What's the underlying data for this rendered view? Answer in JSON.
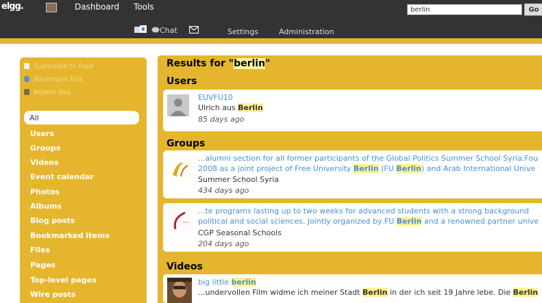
{
  "topbar": {
    "logo": "elgg.",
    "nav": [
      "Dashboard",
      "Tools"
    ],
    "search_value": "berlin",
    "go_label": "Go"
  },
  "secondbar": {
    "chat": "Chat",
    "settings": "Settings",
    "administration": "Administration"
  },
  "sidebar": {
    "owner_links": [
      "Subscribe to feed",
      "Bookmark this",
      "Report this"
    ],
    "menu": [
      "All",
      "Users",
      "Groups",
      "Videos",
      "Event calendar",
      "Photos",
      "Albums",
      "Blog posts",
      "Bookmarked items",
      "Files",
      "Pages",
      "Top-level pages",
      "Wire posts"
    ]
  },
  "results": {
    "title_prefix": "Results for \"",
    "query": "berlin",
    "title_suffix": "\"",
    "keyword": "Berlin",
    "keyword_lower": "berlin",
    "users_title": "Users",
    "groups_title": "Groups",
    "videos_title": "Videos",
    "user": {
      "name": "EUVFU10",
      "desc_prefix": "Ulrich aus ",
      "time": "85 days ago"
    },
    "group1": {
      "line1": "...alumni section for all former participants of the Global Politics Summer School Syria.Fou",
      "line2_a": "2008 as a joint project of Free University ",
      "line2_b": " (FU ",
      "line2_c": ") and Arab International Unive",
      "name": "Summer School Syria",
      "time": "434 days ago"
    },
    "group2": {
      "line1": "...te programs lasting up to two weeks for advanced students with a strong background",
      "line2_a": "political and social sciences. Jointly organized by FU ",
      "line2_b": " and a renowned partner unive",
      "name": "CGP Seasonal Schools",
      "time": "204 days ago"
    },
    "video": {
      "title_prefix": "big little ",
      "line1_a": "...undervollen Film widme ich meiner Stadt ",
      "line1_b": " in der ich seit 19 Jahre lebe. Die "
    }
  },
  "colors": {
    "toolbar": "#333333",
    "gold": "#E5B62D",
    "link": "#4690d6",
    "highlight": "#fff28a"
  }
}
